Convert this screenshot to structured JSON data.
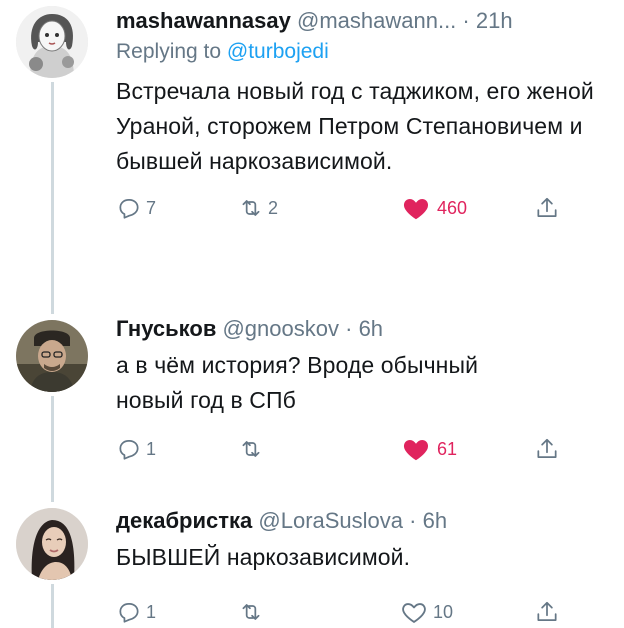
{
  "thread": {
    "tweets": [
      {
        "name": "mashawannasay",
        "handle": "@mashawann...",
        "sep": "·",
        "time": "21h",
        "replying_prefix": "Replying to",
        "replying_mention": "@turbojedi",
        "text": "Встречала новый год с таджиком, его женой Ураной, сторожем Петром Степановичем и бывшей наркозависимой.",
        "replies": "7",
        "retweets": "2",
        "likes": "460",
        "liked": true
      },
      {
        "name": "Гнуськов",
        "handle": "@gnooskov",
        "sep": "·",
        "time": "6h",
        "text": "а в чём история? Вроде обычный новый год в СПб",
        "replies": "1",
        "retweets": "",
        "likes": "61",
        "liked": true
      },
      {
        "name": "декабристка",
        "handle": "@LoraSuslova",
        "sep": "·",
        "time": "6h",
        "text": "БЫВШЕЙ наркозависимой.",
        "replies": "1",
        "retweets": "",
        "likes": "10",
        "liked": false
      }
    ]
  },
  "colors": {
    "text": "#14171a",
    "secondary": "#657786",
    "mention": "#1da1f2",
    "like_active": "#e0245e",
    "thread_line": "#cfd9de"
  },
  "icons": [
    "reply-icon",
    "retweet-icon",
    "like-icon",
    "share-icon"
  ]
}
